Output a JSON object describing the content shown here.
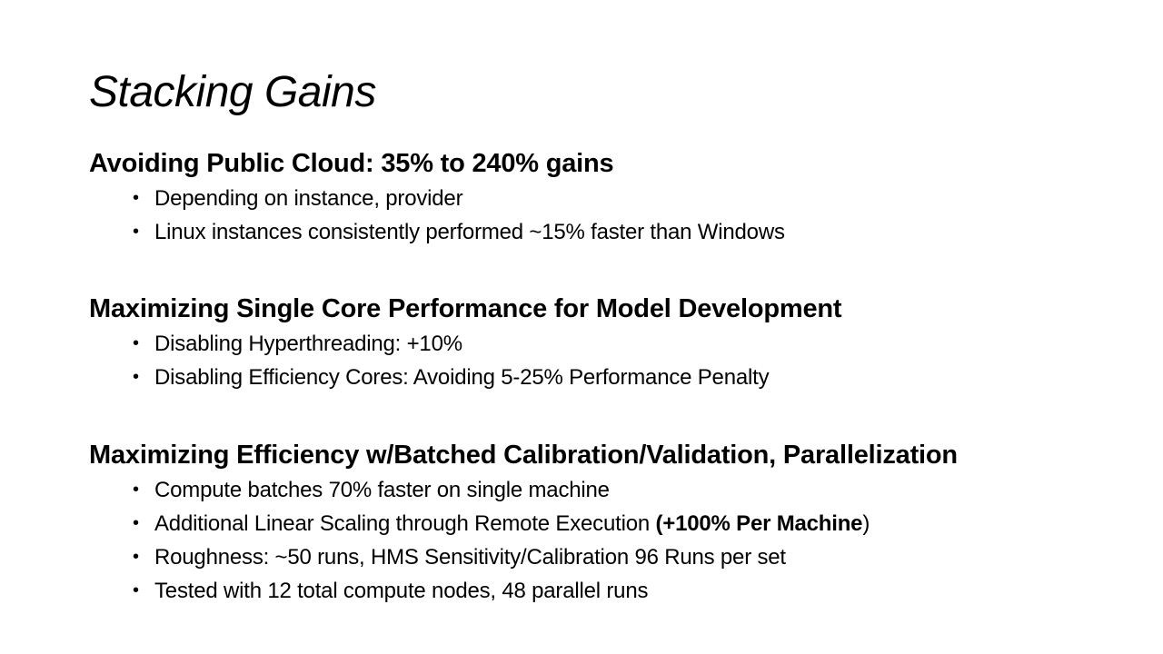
{
  "slide": {
    "title": "Stacking Gains",
    "sections": [
      {
        "heading": "Avoiding Public Cloud:  35% to 240% gains",
        "bullets": [
          "Depending on instance, provider",
          "Linux instances consistently performed ~15% faster than Windows"
        ]
      },
      {
        "heading": "Maximizing Single Core Performance for Model Development",
        "bullets": [
          "Disabling Hyperthreading: +10%",
          "Disabling Efficiency Cores:  Avoiding 5-25% Performance Penalty"
        ]
      },
      {
        "heading": "Maximizing Efficiency w/Batched Calibration/Validation, Parallelization",
        "bullets": [
          "Compute batches 70% faster on single machine",
          "Roughness: ~50 runs, HMS Sensitivity/Calibration 96 Runs per set",
          "Tested with 12 total compute nodes, 48 parallel runs"
        ],
        "mixed_bullet": {
          "prefix": "Additional Linear Scaling through Remote Execution ",
          "open_paren": "(",
          "bold": "+100% Per Machine",
          "close_paren": ")"
        }
      }
    ],
    "bullet_glyph": "•"
  }
}
